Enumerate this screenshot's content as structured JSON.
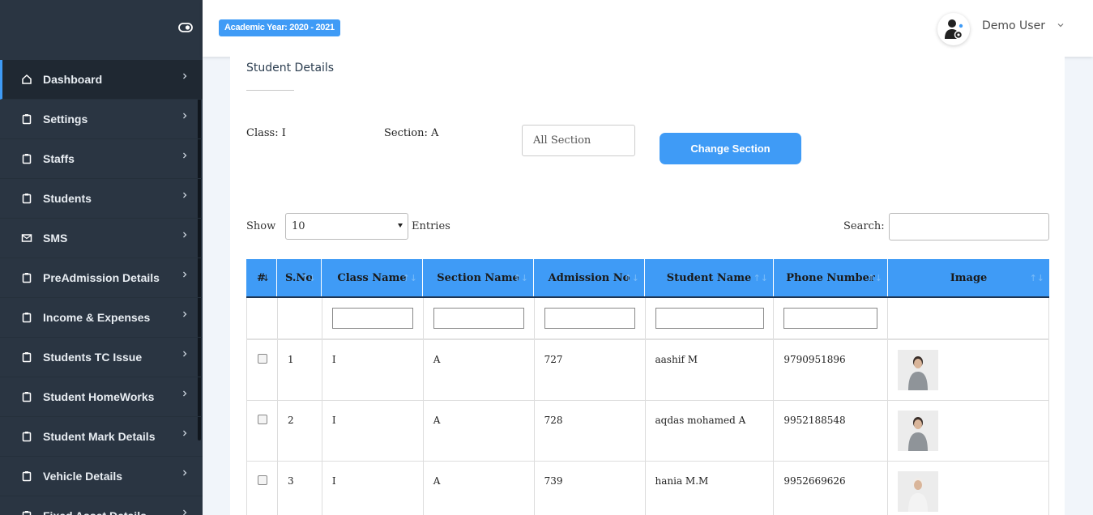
{
  "header": {
    "academic_year": "Academic Year: 2020 - 2021",
    "user_name": "Demo User"
  },
  "sidebar": {
    "items": [
      {
        "label": "Dashboard",
        "icon": "home-icon",
        "active": true
      },
      {
        "label": "Settings",
        "icon": "clipboard-icon"
      },
      {
        "label": "Staffs",
        "icon": "clipboard-icon"
      },
      {
        "label": "Students",
        "icon": "clipboard-icon"
      },
      {
        "label": "SMS",
        "icon": "mail-icon"
      },
      {
        "label": "PreAdmission Details",
        "icon": "clipboard-icon"
      },
      {
        "label": "Income & Expenses",
        "icon": "clipboard-icon"
      },
      {
        "label": "Students TC Issue",
        "icon": "clipboard-icon"
      },
      {
        "label": "Student HomeWorks",
        "icon": "clipboard-icon"
      },
      {
        "label": "Student Mark Details",
        "icon": "clipboard-icon"
      },
      {
        "label": "Vehicle Details",
        "icon": "clipboard-icon"
      },
      {
        "label": "Fixed Asset Details",
        "icon": "clipboard-icon"
      }
    ]
  },
  "main": {
    "title": "Student Details",
    "class_label": "Class: I",
    "section_label": "Section: A",
    "section_select": "All Section",
    "change_button": "Change Section",
    "show_label": "Show",
    "entries_value": "10",
    "entries_label": "Entries",
    "search_label": "Search:"
  },
  "table": {
    "columns": [
      "#",
      "S.No",
      "Class Name",
      "Section Name",
      "Admission No",
      "Student Name",
      "Phone Number",
      "Image"
    ],
    "rows": [
      {
        "sno": "1",
        "class": "I",
        "section": "A",
        "admission": "727",
        "name": "aashif M",
        "phone": "9790951896"
      },
      {
        "sno": "2",
        "class": "I",
        "section": "A",
        "admission": "728",
        "name": "aqdas mohamed A",
        "phone": "9952188548"
      },
      {
        "sno": "3",
        "class": "I",
        "section": "A",
        "admission": "739",
        "name": "hania M.M",
        "phone": "9952669626"
      }
    ]
  },
  "colors": {
    "sidebar_bg": "#2a3542",
    "accent": "#3f9bf6"
  }
}
